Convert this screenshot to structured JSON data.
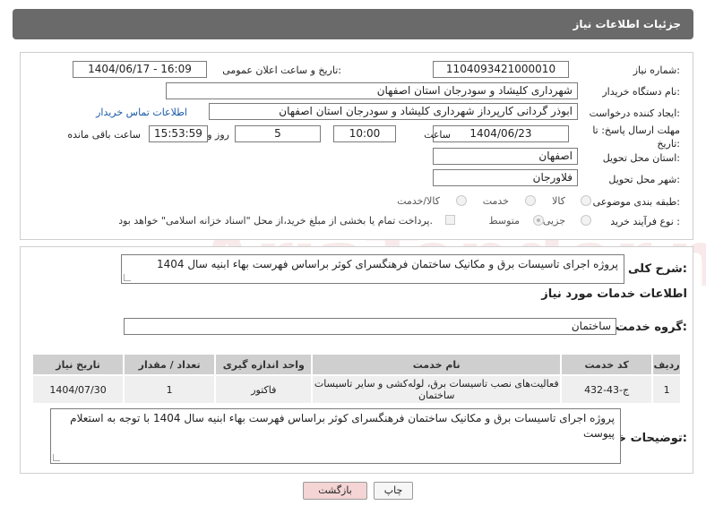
{
  "header": {
    "title": "جزئیات اطلاعات نیاز"
  },
  "form": {
    "need_number_label": "شماره نیاز:",
    "need_number": "1104093421000010",
    "announce_label": "تاریخ و ساعت اعلان عمومی:",
    "announce_value": "1404/06/17 - 16:09",
    "buyer_org_label": "نام دستگاه خریدار:",
    "buyer_org": "شهرداری کلیشاد و سودرجان استان اصفهان",
    "creator_label": "ایجاد کننده درخواست:",
    "creator": "ابوذر گردانی کارپرداز شهرداری کلیشاد و سودرجان استان اصفهان",
    "contact_link": "اطلاعات تماس خریدار",
    "deadline_label": "مهلت ارسال پاسخ: تا تاریخ:",
    "deadline_date": "1404/06/23",
    "time_label": "ساعت",
    "deadline_time": "10:00",
    "days_value": "5",
    "days_label": "روز و",
    "remaining_time": "15:53:59",
    "remaining_label": "ساعت باقی مانده",
    "province_label": "استان محل تحویل:",
    "province": "اصفهان",
    "city_label": "شهر محل تحویل:",
    "city": "فلاورجان",
    "category_label": "طبقه بندی موضوعی:",
    "category_options": [
      "کالا",
      "خدمت",
      "کالا/خدمت"
    ],
    "process_label": "نوع فرآیند خرید :",
    "process_options": [
      "جزیی",
      "متوسط"
    ],
    "payment_note": "پرداخت تمام یا بخشی از مبلغ خرید،از محل \"اسناد خزانه اسلامی\" خواهد بود."
  },
  "details": {
    "summary_label": "شرح کلی نیاز:",
    "summary": "پروژه اجرای تاسیسات برق و مکانیک ساختمان فرهنگسرای کوثر براساس فهرست بهاء  ابنیه سال 1404",
    "services_title": "اطلاعات خدمات مورد نیاز",
    "service_group_label": "گروه خدمت:",
    "service_group": "ساختمان",
    "table": {
      "headers": [
        "ردیف",
        "کد خدمت",
        "نام خدمت",
        "واحد اندازه گیری",
        "تعداد / مقدار",
        "تاریخ نیاز"
      ],
      "rows": [
        [
          "1",
          "ج-43-432",
          "فعالیت‌های نصب تاسیسات برق، لوله‌کشی و سایر تاسیسات ساختمان",
          "فاکتور",
          "1",
          "1404/07/30"
        ]
      ]
    },
    "buyer_notes_label": "توضیحات خریدار:",
    "buyer_notes": "پروژه اجرای تاسیسات برق و مکانیک ساختمان فرهنگسرای کوثر براساس فهرست بهاء  ابنیه سال 1404 با توجه به استعلام پیوست"
  },
  "buttons": {
    "print": "چاپ",
    "back": "بازگشت"
  },
  "watermark": "AriaTender.neT"
}
